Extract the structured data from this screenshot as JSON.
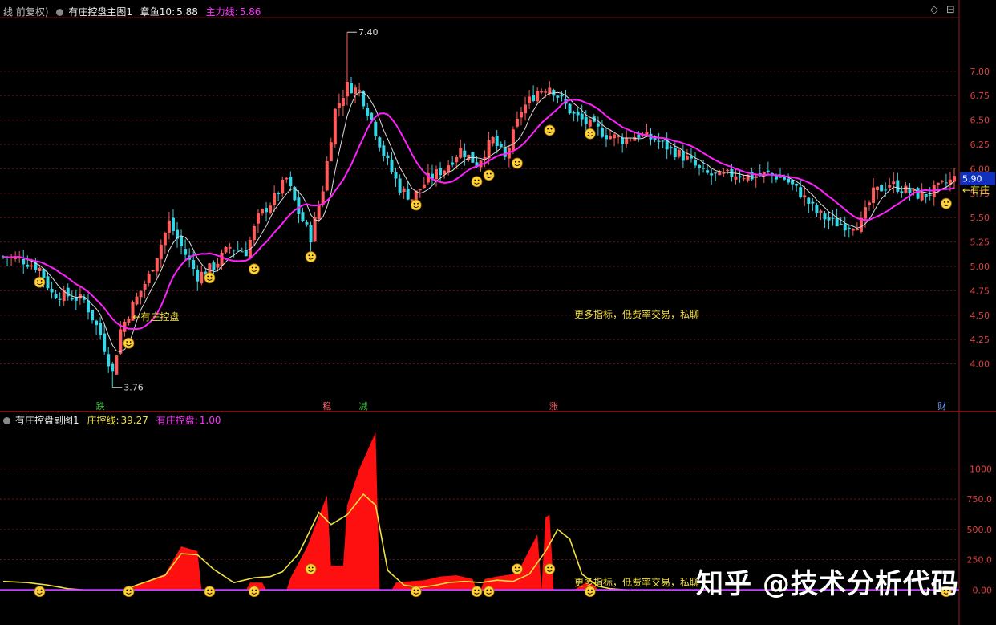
{
  "main_header": {
    "circle_icon": "dropdown-circle-icon",
    "title_partial": "线 前复权)",
    "indicator_name": "有庄控盘主图1",
    "line1_label": "章鱼10:",
    "line1_value": "5.88",
    "line2_label": "主力线:",
    "line2_value": "5.86"
  },
  "sub_header": {
    "indicator_name": "有庄控盘副图1",
    "line1_label": "庄控线:",
    "line1_value": "39.27",
    "line2_label": "有庄控盘:",
    "line2_value": "1.00"
  },
  "window_controls": [
    "◇",
    "⊟"
  ],
  "notes": {
    "main_note": "更多指标，低费率交易，私聊",
    "sub_note": "更多指标，低费率交易，私聊"
  },
  "watermark": "知乎 @技术分析代码",
  "chart_data": [
    {
      "type": "candlestick",
      "ylim": [
        3.7,
        7.55
      ],
      "y_ticks": [
        4.0,
        4.25,
        4.5,
        4.75,
        5.0,
        5.25,
        5.5,
        5.75,
        6.0,
        6.25,
        6.5,
        6.75,
        7.0
      ],
      "y_tick_labels": [
        "4.00",
        "4.25",
        "4.50",
        "4.75",
        "5.00",
        "5.25",
        "5.50",
        "5.75",
        "6.00",
        "6.25",
        "6.50",
        "6.75",
        "7.00"
      ],
      "current_price_label": "5.90",
      "max_label": "7.40",
      "min_label": "3.76",
      "annotations": [
        {
          "text": "有庄控盘",
          "bar": 30,
          "y": 4.48
        },
        {
          "text": "有庄",
          "bar": 235,
          "y": 5.78
        }
      ],
      "bottom_markers": [
        {
          "text": "跌",
          "bar": 24,
          "color": "#39c039"
        },
        {
          "text": "稳",
          "bar": 80,
          "color": "#ff6060"
        },
        {
          "text": "减",
          "bar": 89,
          "color": "#39c039"
        },
        {
          "text": "涨",
          "bar": 136,
          "color": "#ff6060"
        },
        {
          "text": "财",
          "bar": 232,
          "color": "#7fb0ff"
        }
      ],
      "smiley_bars": [
        9,
        31,
        51,
        62,
        76,
        102,
        117,
        120,
        127,
        135,
        145,
        233
      ],
      "close_keypoints": [
        [
          0,
          5.1
        ],
        [
          4,
          5.08
        ],
        [
          9,
          4.98
        ],
        [
          12,
          4.72
        ],
        [
          16,
          4.7
        ],
        [
          20,
          4.65
        ],
        [
          24,
          4.3
        ],
        [
          27,
          3.9
        ],
        [
          29,
          4.35
        ],
        [
          32,
          4.6
        ],
        [
          36,
          4.9
        ],
        [
          41,
          5.45
        ],
        [
          44,
          5.2
        ],
        [
          48,
          4.9
        ],
        [
          52,
          5.0
        ],
        [
          56,
          5.2
        ],
        [
          60,
          5.15
        ],
        [
          63,
          5.5
        ],
        [
          67,
          5.7
        ],
        [
          70,
          5.9
        ],
        [
          73,
          5.55
        ],
        [
          76,
          5.3
        ],
        [
          79,
          5.8
        ],
        [
          82,
          6.6
        ],
        [
          85,
          6.85
        ],
        [
          88,
          6.8
        ],
        [
          91,
          6.5
        ],
        [
          94,
          6.15
        ],
        [
          98,
          5.8
        ],
        [
          101,
          5.7
        ],
        [
          105,
          5.9
        ],
        [
          109,
          6.0
        ],
        [
          113,
          6.2
        ],
        [
          117,
          6.05
        ],
        [
          121,
          6.3
        ],
        [
          124,
          6.1
        ],
        [
          128,
          6.6
        ],
        [
          132,
          6.8
        ],
        [
          135,
          6.85
        ],
        [
          138,
          6.7
        ],
        [
          141,
          6.55
        ],
        [
          145,
          6.45
        ],
        [
          149,
          6.35
        ],
        [
          153,
          6.3
        ],
        [
          157,
          6.35
        ],
        [
          161,
          6.3
        ],
        [
          165,
          6.2
        ],
        [
          169,
          6.1
        ],
        [
          173,
          5.95
        ],
        [
          177,
          5.92
        ],
        [
          181,
          5.95
        ],
        [
          185,
          5.92
        ],
        [
          189,
          5.95
        ],
        [
          193,
          5.9
        ],
        [
          197,
          5.75
        ],
        [
          201,
          5.55
        ],
        [
          205,
          5.45
        ],
        [
          209,
          5.42
        ],
        [
          212,
          5.45
        ],
        [
          215,
          5.75
        ],
        [
          219,
          5.85
        ],
        [
          223,
          5.78
        ],
        [
          227,
          5.72
        ],
        [
          231,
          5.8
        ],
        [
          235,
          5.9
        ]
      ],
      "mas": [
        {
          "name": "章鱼10",
          "value": 5.88,
          "color": "#dddddd"
        },
        {
          "name": "主力线",
          "value": 5.86,
          "color": "#ff20ff"
        }
      ]
    },
    {
      "type": "area",
      "ylim": [
        -230,
        1360
      ],
      "y_ticks": [
        0,
        250,
        500,
        750,
        1000
      ],
      "y_tick_labels": [
        "0.00",
        "250.0",
        "500.0",
        "750.0",
        "1000"
      ],
      "series": [
        {
          "name": "庄控线",
          "value": 39.27,
          "color": "#f0e040"
        },
        {
          "name": "有庄控盘",
          "value": 1.0,
          "color": "#c040ff"
        }
      ],
      "line_keypoints": [
        [
          0,
          70
        ],
        [
          6,
          60
        ],
        [
          11,
          40
        ],
        [
          16,
          10
        ],
        [
          20,
          0
        ],
        [
          30,
          0
        ],
        [
          33,
          40
        ],
        [
          40,
          120
        ],
        [
          44,
          300
        ],
        [
          48,
          290
        ],
        [
          52,
          170
        ],
        [
          57,
          60
        ],
        [
          62,
          100
        ],
        [
          66,
          110
        ],
        [
          69,
          150
        ],
        [
          73,
          300
        ],
        [
          78,
          640
        ],
        [
          81,
          540
        ],
        [
          85,
          620
        ],
        [
          89,
          790
        ],
        [
          92,
          700
        ],
        [
          95,
          160
        ],
        [
          99,
          40
        ],
        [
          103,
          20
        ],
        [
          107,
          40
        ],
        [
          110,
          60
        ],
        [
          114,
          70
        ],
        [
          118,
          60
        ],
        [
          122,
          80
        ],
        [
          126,
          70
        ],
        [
          130,
          130
        ],
        [
          134,
          320
        ],
        [
          137,
          500
        ],
        [
          140,
          420
        ],
        [
          143,
          130
        ],
        [
          147,
          30
        ],
        [
          150,
          10
        ],
        [
          154,
          0
        ],
        [
          235,
          0
        ]
      ],
      "fill_keypoints": [
        [
          0,
          0
        ],
        [
          30,
          0
        ],
        [
          31,
          5
        ],
        [
          36,
          80
        ],
        [
          40,
          130
        ],
        [
          44,
          360
        ],
        [
          48,
          320
        ],
        [
          49,
          0
        ],
        [
          60,
          0
        ],
        [
          61,
          60
        ],
        [
          64,
          60
        ],
        [
          65,
          0
        ],
        [
          70,
          0
        ],
        [
          71,
          100
        ],
        [
          75,
          350
        ],
        [
          80,
          780
        ],
        [
          81,
          200
        ],
        [
          84,
          200
        ],
        [
          85,
          700
        ],
        [
          88,
          1000
        ],
        [
          92,
          1300
        ],
        [
          93,
          0
        ],
        [
          96,
          0
        ],
        [
          97,
          60
        ],
        [
          100,
          70
        ],
        [
          104,
          80
        ],
        [
          108,
          110
        ],
        [
          112,
          120
        ],
        [
          116,
          90
        ],
        [
          117,
          0
        ],
        [
          118,
          0
        ],
        [
          119,
          90
        ],
        [
          122,
          110
        ],
        [
          126,
          130
        ],
        [
          128,
          200
        ],
        [
          132,
          460
        ],
        [
          133,
          0
        ],
        [
          134,
          600
        ],
        [
          135,
          620
        ],
        [
          136,
          0
        ],
        [
          140,
          0
        ],
        [
          141,
          0
        ],
        [
          144,
          60
        ],
        [
          146,
          40
        ],
        [
          147,
          0
        ],
        [
          235,
          0
        ]
      ]
    }
  ]
}
